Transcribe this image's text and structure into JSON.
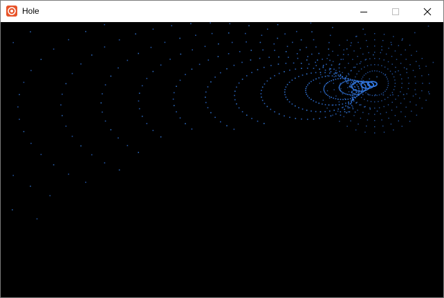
{
  "window": {
    "title": "Hole",
    "controls": {
      "minimize": "minimize",
      "maximize": "maximize",
      "close": "close"
    }
  },
  "scene": {
    "background_color": "#000000",
    "dot_color": "#2f6fd6",
    "dot_color_bright": "#3a86f0"
  },
  "colors": {
    "app_icon": "#e8542a",
    "titlebar": "#ffffff"
  }
}
